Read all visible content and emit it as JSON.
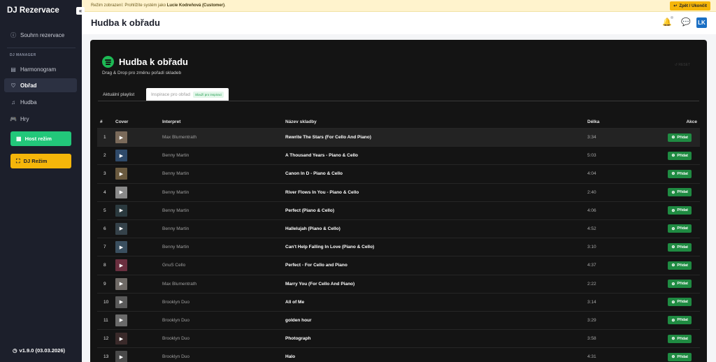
{
  "sidebar": {
    "brand": "DJ Rezervace",
    "collapse": "«",
    "summary": {
      "label": "Souhrn rezervace",
      "icon": "ⓘ"
    },
    "section": "DJ MANAGER",
    "items": [
      {
        "label": "Harmonogram",
        "icon": "▤"
      },
      {
        "label": "Obřad",
        "icon": "♡"
      },
      {
        "label": "Hudba",
        "icon": "♫"
      },
      {
        "label": "Hry",
        "icon": "🎮"
      }
    ],
    "host_mode": {
      "label": "Host režim",
      "icon": "▦"
    },
    "dj_mode": {
      "label": "DJ Režim",
      "icon": "⛶"
    },
    "version": "v1.9.0 (03.03.2026)",
    "version_icon": "◷"
  },
  "banner": {
    "prefix": "Režim zobrazení: Prohlížíte systém jako",
    "user": "Lucie Kodreňová (Customer)",
    "suffix": ".",
    "back_label": "Zpět / Ukončit",
    "back_icon": "↩"
  },
  "header": {
    "title": "Hudba k obřadu",
    "bell_icon": "🔔",
    "chat_icon": "💬",
    "avatar": "LK"
  },
  "panel": {
    "title": "Hudba k obřadu",
    "subtitle": "Drag & Drop pro změnu pořadí skladeb",
    "reset": "↺ RESET",
    "tabs": [
      {
        "label": "Aktuální playlist"
      },
      {
        "label": "Inspirace pro obřad",
        "badge": "Slouží pro inspiraci"
      }
    ]
  },
  "table": {
    "columns": {
      "num": "#",
      "cover": "Cover",
      "artist": "Interpret",
      "title": "Název skladby",
      "length": "Délka",
      "action": "Akce"
    },
    "add_label": "Přidat",
    "add_icon": "⊕",
    "play_icon": "▶",
    "rows": [
      {
        "num": "1",
        "artist": "Max Blumentrath",
        "title": "Rewrite The Stars (For Cello And Piano)",
        "length": "3:34",
        "cover_color": "#7a6a5a"
      },
      {
        "num": "2",
        "artist": "Benny Martin",
        "title": "A Thousand Years - Piano & Cello",
        "length": "5:03",
        "cover_color": "#2f4a6a"
      },
      {
        "num": "3",
        "artist": "Benny Martin",
        "title": "Canon In D - Piano & Cello",
        "length": "4:04",
        "cover_color": "#6a5a3f"
      },
      {
        "num": "4",
        "artist": "Benny Martin",
        "title": "River Flows In You - Piano & Cello",
        "length": "2:40",
        "cover_color": "#8a8a8a"
      },
      {
        "num": "5",
        "artist": "Benny Martin",
        "title": "Perfect (Piano & Cello)",
        "length": "4:06",
        "cover_color": "#2b3a3f"
      },
      {
        "num": "6",
        "artist": "Benny Martin",
        "title": "Hallelujah (Piano & Cello)",
        "length": "4:52",
        "cover_color": "#35424a"
      },
      {
        "num": "7",
        "artist": "Benny Martin",
        "title": "Can't Help Falling In Love (Piano & Cello)",
        "length": "3:10",
        "cover_color": "#3a4f5f"
      },
      {
        "num": "8",
        "artist": "GnuS Cello",
        "title": "Perfect - For Cello and Piano",
        "length": "4:37",
        "cover_color": "#6a2f3f"
      },
      {
        "num": "9",
        "artist": "Max Blumentrath",
        "title": "Marry You (For Cello And Piano)",
        "length": "2:22",
        "cover_color": "#6f6a66"
      },
      {
        "num": "10",
        "artist": "Brooklyn Duo",
        "title": "All of Me",
        "length": "3:14",
        "cover_color": "#5a5a5a"
      },
      {
        "num": "11",
        "artist": "Brooklyn Duo",
        "title": "golden hour",
        "length": "3:29",
        "cover_color": "#6a6a6a"
      },
      {
        "num": "12",
        "artist": "Brooklyn Duo",
        "title": "Photograph",
        "length": "3:58",
        "cover_color": "#3a2a2a"
      },
      {
        "num": "13",
        "artist": "Brooklyn Duo",
        "title": "Halo",
        "length": "4:31",
        "cover_color": "#4a4a4a"
      }
    ]
  }
}
